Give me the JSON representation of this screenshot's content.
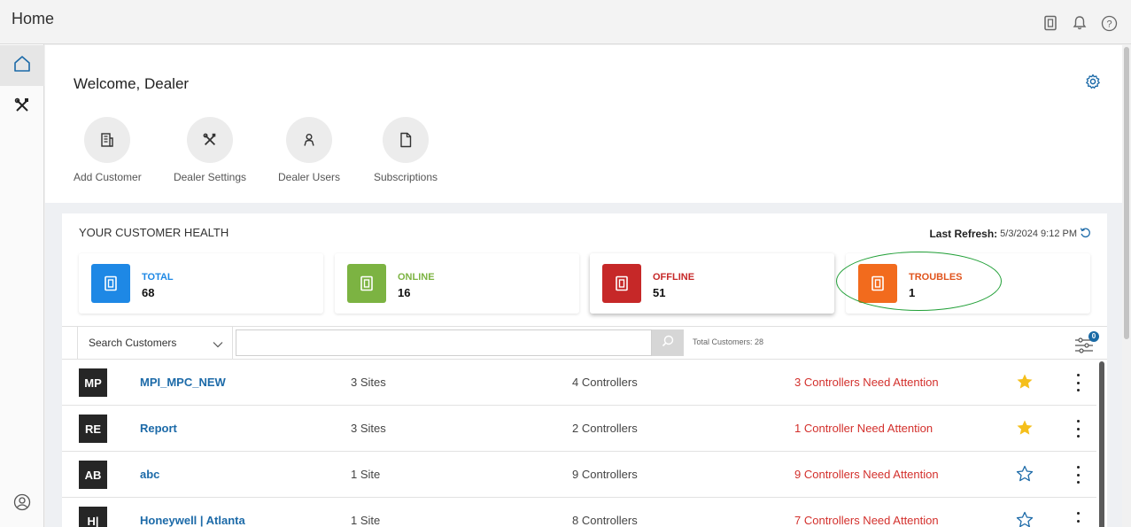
{
  "header": {
    "title": "Home",
    "icons": [
      "device-icon",
      "bell-icon",
      "help-icon"
    ]
  },
  "sidebar": {
    "items": [
      {
        "icon": "home-icon",
        "active": true
      },
      {
        "icon": "tools-icon",
        "active": false
      }
    ],
    "bottom_icon": "user-circle-icon"
  },
  "welcome": {
    "title": "Welcome, Dealer",
    "settings_icon": "gear-icon",
    "quick_actions": [
      {
        "label": "Add Customer",
        "icon": "building-icon"
      },
      {
        "label": "Dealer Settings",
        "icon": "tools-icon"
      },
      {
        "label": "Dealer Users",
        "icon": "person-icon"
      },
      {
        "label": "Subscriptions",
        "icon": "document-icon"
      }
    ]
  },
  "health": {
    "title": "YOUR CUSTOMER HEALTH",
    "refresh_label": "Last Refresh:",
    "refresh_value": "5/3/2024 9:12 PM",
    "cards": [
      {
        "title": "TOTAL",
        "value": "68",
        "color": "#1e88e5",
        "title_color": "#1e88e5"
      },
      {
        "title": "ONLINE",
        "value": "16",
        "color": "#7cb342",
        "title_color": "#7cb342"
      },
      {
        "title": "OFFLINE",
        "value": "51",
        "color": "#c62828",
        "title_color": "#c62828"
      },
      {
        "title": "TROUBLES",
        "value": "1",
        "color": "#f26b1d",
        "title_color": "#e0541d"
      }
    ],
    "selected_card": "OFFLINE",
    "annotation_color": "#22a038"
  },
  "search": {
    "select_label": "Search Customers",
    "placeholder": "",
    "total_label": "Total Customers: 28",
    "filter_badge": "0"
  },
  "customers": [
    {
      "initials": "MP",
      "name": "MPI_MPC_NEW",
      "sites": "3  Sites",
      "controllers": "4  Controllers",
      "attention": "3  Controllers Need Attention",
      "favorite": true
    },
    {
      "initials": "RE",
      "name": "Report",
      "sites": "3  Sites",
      "controllers": "2  Controllers",
      "attention": "1  Controller Need Attention",
      "favorite": true
    },
    {
      "initials": "AB",
      "name": "abc",
      "sites": "1  Site",
      "controllers": "9  Controllers",
      "attention": "9  Controllers Need Attention",
      "favorite": false
    },
    {
      "initials": "H|",
      "name": "Honeywell | Atlanta",
      "sites": "1  Site",
      "controllers": "8  Controllers",
      "attention": "7  Controllers Need Attention",
      "favorite": false
    }
  ],
  "colors": {
    "accent": "#1c6aa8",
    "attention": "#d3302c",
    "star": "#f5bf1b"
  }
}
